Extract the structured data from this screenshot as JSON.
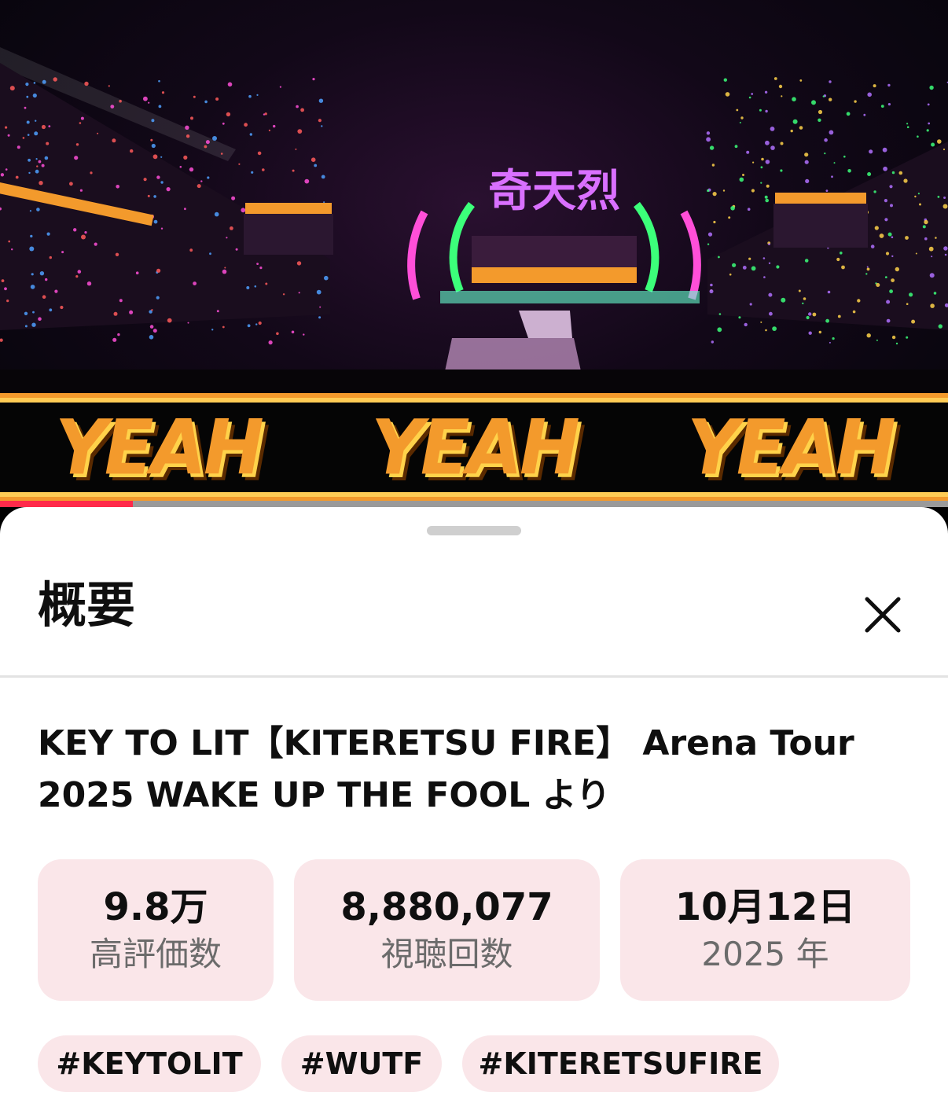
{
  "video": {
    "banner_words": [
      "YEAH",
      "YEAH",
      "YEAH"
    ],
    "stage_sign": "奇天烈",
    "progress_fraction": 0.14,
    "progress_color": "#ff2a4a"
  },
  "sheet": {
    "title": "概要",
    "close_icon": "close-icon",
    "video_title": "KEY TO LIT【KITERETSU FIRE】 Arena Tour 2025 WAKE UP THE FOOL より",
    "stats": [
      {
        "value": "9.8万",
        "label": "高評価数"
      },
      {
        "value": "8,880,077",
        "label": "視聴回数"
      },
      {
        "value": "10月12日",
        "label": "2025 年"
      }
    ],
    "hashtags": [
      "#KEYTOLIT",
      "#WUTF",
      "#KITERETSUFIRE"
    ],
    "accent_bg": "#fae6e9"
  }
}
